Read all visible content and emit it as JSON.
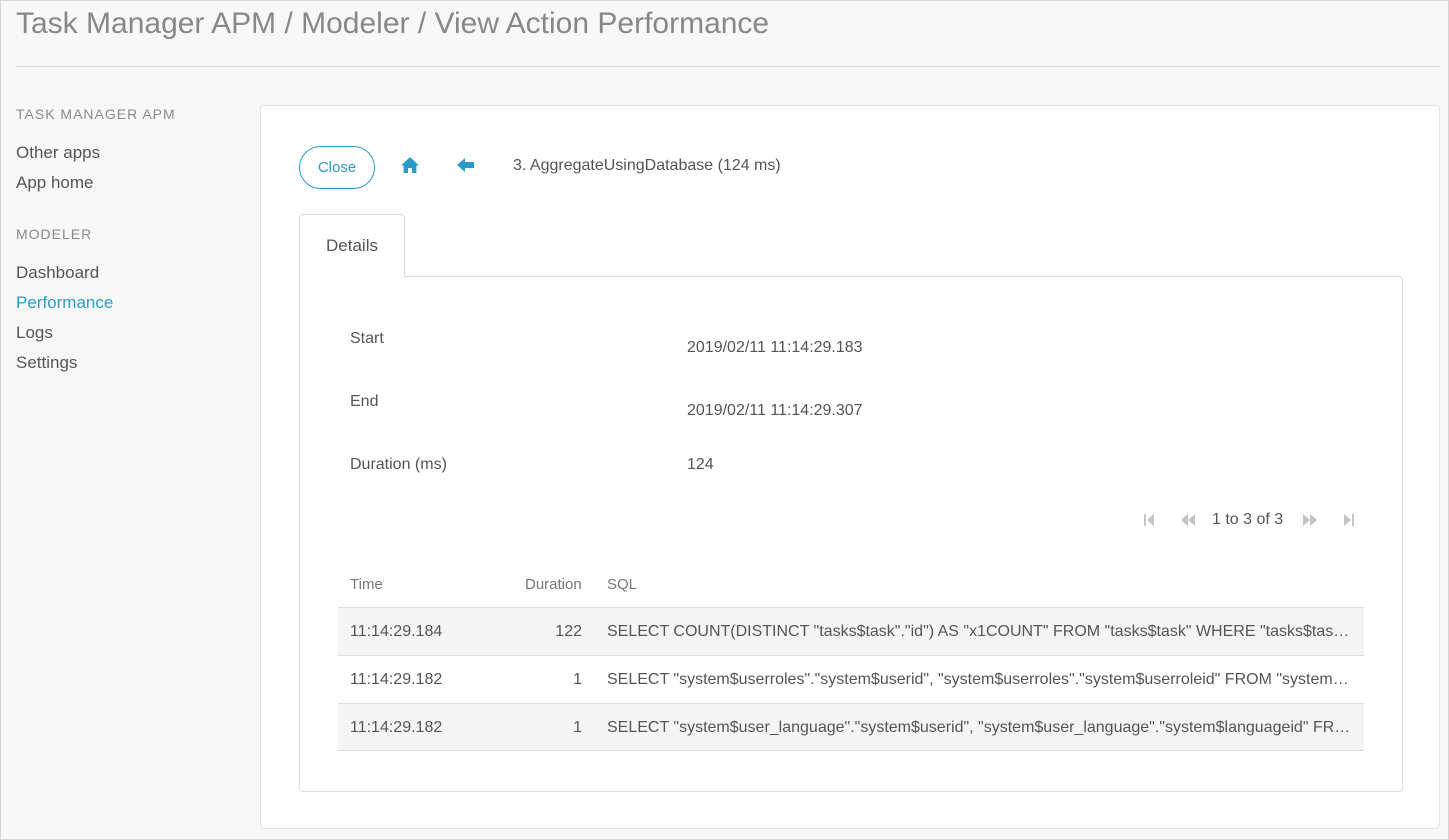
{
  "page": {
    "title": "Task Manager APM / Modeler / View Action Performance"
  },
  "sidebar": {
    "sections": [
      {
        "heading": "TASK MANAGER APM",
        "items": [
          "Other apps",
          "App home"
        ]
      },
      {
        "heading": "MODELER",
        "items": [
          "Dashboard",
          "Performance",
          "Logs",
          "Settings"
        ],
        "active": "Performance"
      }
    ]
  },
  "toolbar": {
    "close_label": "Close",
    "home_icon": "home-icon",
    "back_icon": "arrow-left-icon",
    "breadcrumb": "3. AggregateUsingDatabase (124 ms)"
  },
  "tabs": [
    {
      "label": "Details",
      "active": true
    }
  ],
  "details": {
    "start_label": "Start",
    "start_value": "2019/02/11 11:14:29.183",
    "end_label": "End",
    "end_value": "2019/02/11 11:14:29.307",
    "duration_label": "Duration (ms)",
    "duration_value": "124"
  },
  "pager": {
    "text": "1 to 3 of 3",
    "icons": [
      "first-page-icon",
      "previous-page-icon",
      "next-page-icon",
      "last-page-icon"
    ]
  },
  "table": {
    "columns": [
      "Time",
      "Duration",
      "SQL"
    ],
    "rows": [
      {
        "time": "11:14:29.184",
        "duration": "122",
        "sql": "SELECT COUNT(DISTINCT \"tasks$task\".\"id\") AS \"x1COUNT\" FROM \"tasks$task\" WHERE \"tasks$task\".\"status\" = ?"
      },
      {
        "time": "11:14:29.182",
        "duration": "1",
        "sql": "SELECT \"system$userroles\".\"system$userid\", \"system$userroles\".\"system$userroleid\" FROM \"system$userroles\""
      },
      {
        "time": "11:14:29.182",
        "duration": "1",
        "sql": "SELECT \"system$user_language\".\"system$userid\", \"system$user_language\".\"system$languageid\" FROM \"system$user_language\""
      }
    ]
  },
  "colors": {
    "accent": "#2a9cc8",
    "text": "#555555",
    "muted": "#888888",
    "row_shade": "#f5f5f5",
    "border": "#dddddd"
  }
}
